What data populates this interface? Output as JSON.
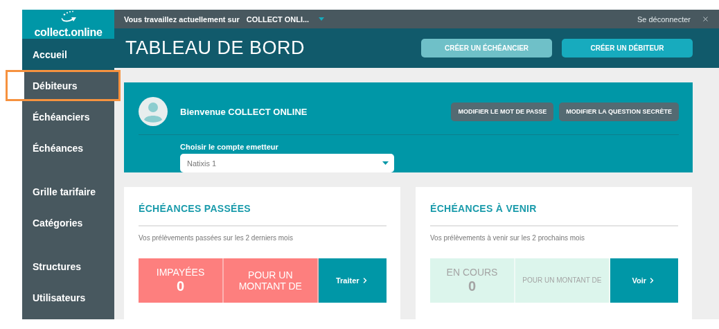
{
  "topbar": {
    "working_on_label": "Vous travaillez actuellement sur",
    "account": "COLLECT ONLI...",
    "logout": "Se déconnecter"
  },
  "logo": {
    "text": "collect.online"
  },
  "header": {
    "title": "TABLEAU DE BORD",
    "buttons": [
      {
        "label": "CRÉER UN ÉCHÉANCIER",
        "kind": "light"
      },
      {
        "label": "CRÉER UN DÉBITEUR",
        "kind": "primary"
      }
    ]
  },
  "sidebar": {
    "groups": [
      {
        "items": [
          {
            "label": "Accueil",
            "selected": true,
            "highlighted": false
          },
          {
            "label": "Débiteurs",
            "selected": false,
            "highlighted": true
          },
          {
            "label": "Échéanciers",
            "selected": false,
            "highlighted": false
          },
          {
            "label": "Échéances",
            "selected": false,
            "highlighted": false
          }
        ]
      },
      {
        "items": [
          {
            "label": "Grille tarifaire",
            "selected": false,
            "highlighted": false
          },
          {
            "label": "Catégories",
            "selected": false,
            "highlighted": false
          }
        ]
      },
      {
        "items": [
          {
            "label": "Structures",
            "selected": false,
            "highlighted": false
          },
          {
            "label": "Utilisateurs",
            "selected": false,
            "highlighted": false
          }
        ]
      }
    ]
  },
  "welcome": {
    "greeting": "Bienvenue COLLECT ONLINE",
    "buttons": [
      "MODIFIER LE MOT DE PASSE",
      "MODIFIER LA QUESTION SECRÈTE"
    ],
    "account_label": "Choisir le compte emetteur",
    "account_value": "Natixis 1"
  },
  "cards": [
    {
      "title": "ÉCHÉANCES PASSÉES",
      "subtitle": "Vos prélèvements passées sur les 2 derniers mois",
      "kind": "alert",
      "status_label": "IMPAYÉES",
      "count": "0",
      "amount_label": "POUR UN MONTANT DE",
      "action": "Traiter"
    },
    {
      "title": "ÉCHÉANCES À VENIR",
      "subtitle": "Vos prélèvements à venir sur les 2 prochains mois",
      "kind": "calm",
      "status_label": "EN COURS",
      "count": "0",
      "amount_label": "POUR UN MONTANT DE",
      "action": "Voir"
    }
  ]
}
